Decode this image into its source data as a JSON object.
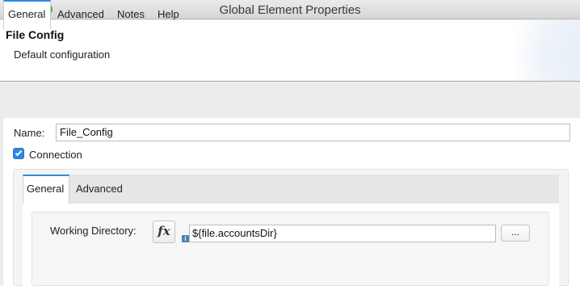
{
  "window": {
    "title": "Global Element Properties"
  },
  "header": {
    "title": "File Config",
    "description": "Default configuration"
  },
  "tabs": [
    "General",
    "Advanced",
    "Notes",
    "Help"
  ],
  "general": {
    "name_label": "Name:",
    "name_value": "File_Config",
    "connection_label": "Connection",
    "connection_checked": true
  },
  "connection": {
    "tabs": [
      "General",
      "Advanced"
    ],
    "working_directory_label": "Working Directory:",
    "working_directory_value": "${file.accountsDir}",
    "fx_label": "fx",
    "info_glyph": "i",
    "browse_label": "..."
  },
  "colors": {
    "accent": "#2d8be0",
    "checkbox": "#2e87e6"
  },
  "icons": {
    "expression": "fx-icon",
    "info": "info-icon",
    "check": "checkmark-icon"
  }
}
